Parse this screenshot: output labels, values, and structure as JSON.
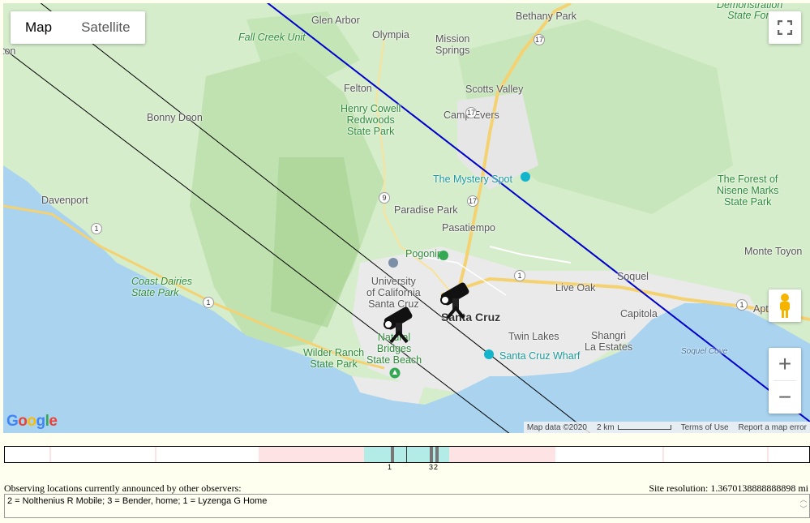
{
  "map": {
    "tabs": {
      "map": "Map",
      "satellite": "Satellite"
    },
    "places": [
      {
        "id": "glen-arbor",
        "label": "Glen Arbor"
      },
      {
        "id": "olympia",
        "label": "Olympia"
      },
      {
        "id": "mission-springs",
        "label": "Mission\nSprings"
      },
      {
        "id": "bethany-park",
        "label": "Bethany Park"
      },
      {
        "id": "demonstration",
        "label": "Demonstration\nState Forest"
      },
      {
        "id": "fall-creek",
        "label": "Fall Creek Unit"
      },
      {
        "id": "felton",
        "label": "Felton"
      },
      {
        "id": "scotts-valley",
        "label": "Scotts Valley"
      },
      {
        "id": "bonny-doon",
        "label": "Bonny Doon"
      },
      {
        "id": "henry-cowell",
        "label": "Henry Cowell\nRedwoods\nState Park"
      },
      {
        "id": "camp-evers",
        "label": "Camp Evers"
      },
      {
        "id": "mystery-spot",
        "label": "The Mystery Spot"
      },
      {
        "id": "forest-nisene",
        "label": "The Forest of\nNisene Marks\nState Park"
      },
      {
        "id": "davenport",
        "label": "Davenport"
      },
      {
        "id": "paradise-park",
        "label": "Paradise Park"
      },
      {
        "id": "pasatiempo",
        "label": "Pasatiempo"
      },
      {
        "id": "pogonip",
        "label": "Pogonip"
      },
      {
        "id": "monte-toyon",
        "label": "Monte Toyon"
      },
      {
        "id": "coast-dairies",
        "label": "Coast Dairies\nState Park"
      },
      {
        "id": "ucsc",
        "label": "University\nof California\nSanta Cruz"
      },
      {
        "id": "live-oak",
        "label": "Live Oak"
      },
      {
        "id": "soquel",
        "label": "Soquel"
      },
      {
        "id": "santa-cruz",
        "label": "Santa Cruz"
      },
      {
        "id": "capitola",
        "label": "Capitola"
      },
      {
        "id": "apt",
        "label": "Apt"
      },
      {
        "id": "natural-bridges",
        "label": "Natural\nBridges\nState Beach"
      },
      {
        "id": "twin-lakes",
        "label": "Twin Lakes"
      },
      {
        "id": "shangri-la",
        "label": "Shangri\nLa Estates"
      },
      {
        "id": "wilder-ranch",
        "label": "Wilder Ranch\nState Park"
      },
      {
        "id": "santa-cruz-wharf",
        "label": "Santa Cruz Wharf"
      },
      {
        "id": "soquel-cove",
        "label": "Soquel Cove"
      },
      {
        "id": "ton",
        "label": "ton"
      }
    ],
    "routes": [
      "17",
      "17",
      "9",
      "17",
      "1",
      "1",
      "1",
      "1"
    ],
    "google_logo": "Google",
    "attribution": {
      "map_data": "Map data ©2020",
      "scale": "2 km",
      "terms": "Terms of Use",
      "report": "Report a map error"
    }
  },
  "timeline": {
    "markers": [
      {
        "label": "1"
      },
      {
        "label": "3"
      },
      {
        "label": "2"
      }
    ]
  },
  "observers": {
    "title": "Observing locations currently announced by other observers:",
    "site_resolution": "Site resolution: 1.3670138888888898 mi",
    "list_text": "2 = Nolthenius R Mobile; 3 = Bender, home; 1 = Lyzenga G Home"
  },
  "colors": {
    "land": "#d9efcf",
    "water": "#a8d4f0",
    "urban": "#ececec",
    "center_line": "#0000cc",
    "limit_line": "#000000",
    "road": "#f8d26a"
  }
}
